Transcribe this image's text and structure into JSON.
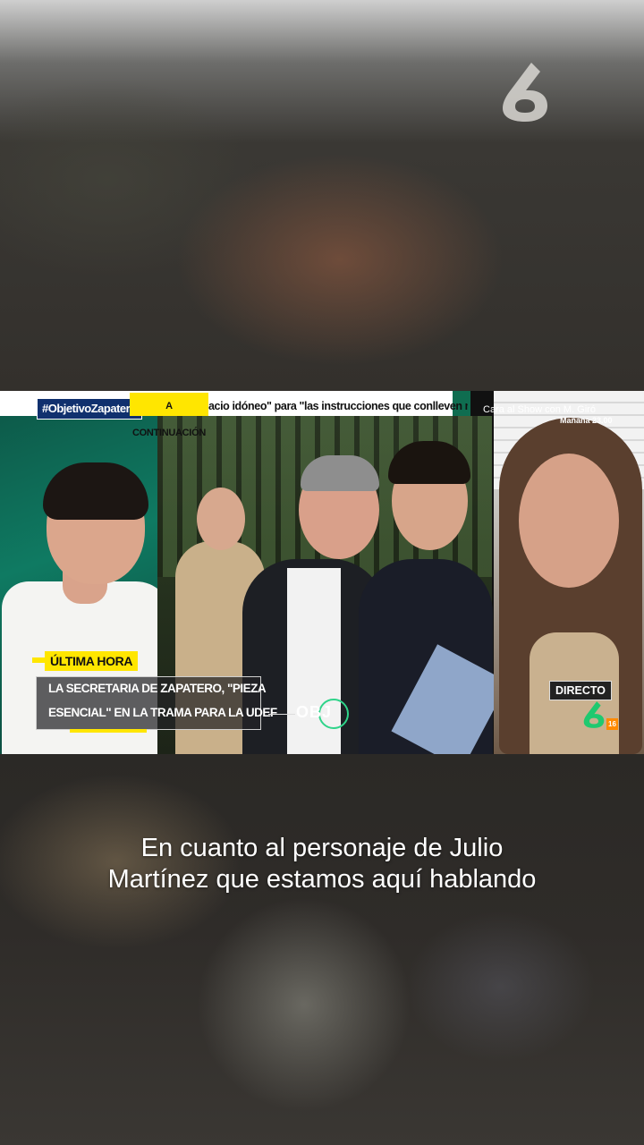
{
  "channel": {
    "logo_icon": "lasexta-6-logo-icon"
  },
  "broadcast": {
    "hashtag": "#ObjetivoZapatero",
    "next_label": "A CONTINUACIÓN",
    "ticker_text": "acio idóneo\" para \"las instrucciones que conlleven m",
    "guest_caption": "Cara al Show con M. Giró",
    "guest_time": "Mañana 23.00",
    "breaking_label": "ÚLTIMA HORA",
    "headline_line1": "LA SECRETARIA DE ZAPATERO, \"PIEZA",
    "headline_line2": "ESENCIAL\" EN LA TRAMA PARA LA UDEF",
    "show_tag": "OBJ",
    "live_label": "DIRECTO",
    "age_rating": "16"
  },
  "subtitles": {
    "line1": "En cuanto al personaje de Julio",
    "line2": "Martínez que estamos aquí hablando"
  },
  "colors": {
    "accent_yellow": "#ffe600",
    "hashtag_blue": "#10306e",
    "logo_green": "#1fc96f"
  }
}
